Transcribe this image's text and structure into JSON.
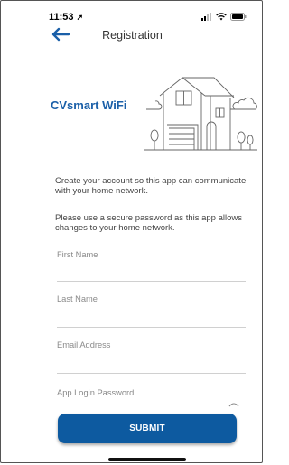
{
  "status_bar": {
    "time": "11:53"
  },
  "header": {
    "title": "Registration"
  },
  "brand": {
    "name": "CVsmart WiFi"
  },
  "intro": {
    "line1": "Create your account so this app can communicate with your home network.",
    "line2": "Please use a secure password as this app allows changes to your home network."
  },
  "form": {
    "first_name": "First Name",
    "last_name": "Last Name",
    "email": "Email Address",
    "password": "App Login Password",
    "submit_label": "SUBMIT"
  },
  "colors": {
    "brand": "#1a5fa8",
    "button": "#0d5aa0"
  },
  "icons": [
    "back-arrow-icon",
    "signal-icon",
    "wifi-icon",
    "battery-icon",
    "location-arrow-icon",
    "eye-icon",
    "house-illustration"
  ]
}
